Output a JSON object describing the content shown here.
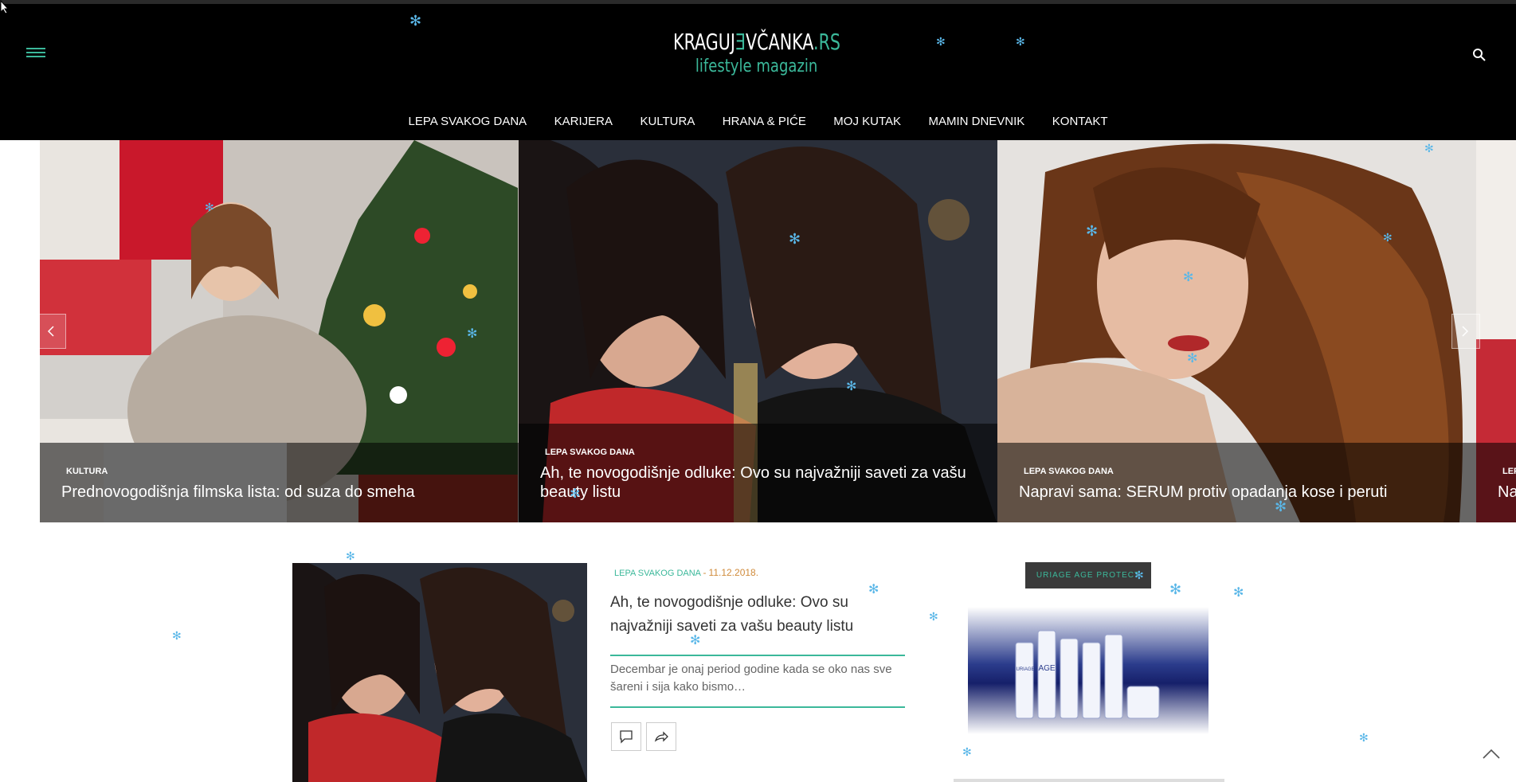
{
  "site": {
    "logo_part1": "KRAGUJ",
    "logo_part2": "Ǝ",
    "logo_part3": "VČANKA",
    "logo_part4": ".RS",
    "tagline": "lifestyle magazin"
  },
  "nav": {
    "items": [
      "LEPA SVAKOG DANA",
      "KARIJERA",
      "KULTURA",
      "HRANA & PIĆE",
      "MOJ KUTAK",
      "MAMIN DNEVNIK",
      "KONTAKT"
    ]
  },
  "slider": {
    "slides": [
      {
        "category": "KULTURA",
        "title": "Prednovogodišnja filmska lista: od suza do smeha"
      },
      {
        "category": "LEPA SVAKOG DANA",
        "title": "Ah, te novogodišnje odluke: Ovo su najvažniji saveti za vašu beauty listu"
      },
      {
        "category": "LEPA SVAKOG DANA",
        "title": "Napravi sama: SERUM protiv opadanja kose i peruti"
      },
      {
        "category": "LEPA SVAKOG DANA",
        "title": "Na"
      }
    ]
  },
  "post": {
    "category": "LEPA SVAKOG DANA",
    "date_sep": "-",
    "date": "11.12.2018.",
    "title": "Ah, te novogodišnje odluke: Ovo su najvažniji saveti za vašu beauty listu",
    "excerpt": "Decembar je onaj period godine kada se oko nas sve šareni i sija  kako bismo…"
  },
  "sidebar": {
    "ad_label": "URIAGE AGE PROTECT",
    "product_brand": "URIAGE",
    "product_line": "AGE"
  },
  "colors": {
    "accent": "#3bb89a",
    "date": "#d08b3b",
    "snow": "#5ab7e8"
  }
}
